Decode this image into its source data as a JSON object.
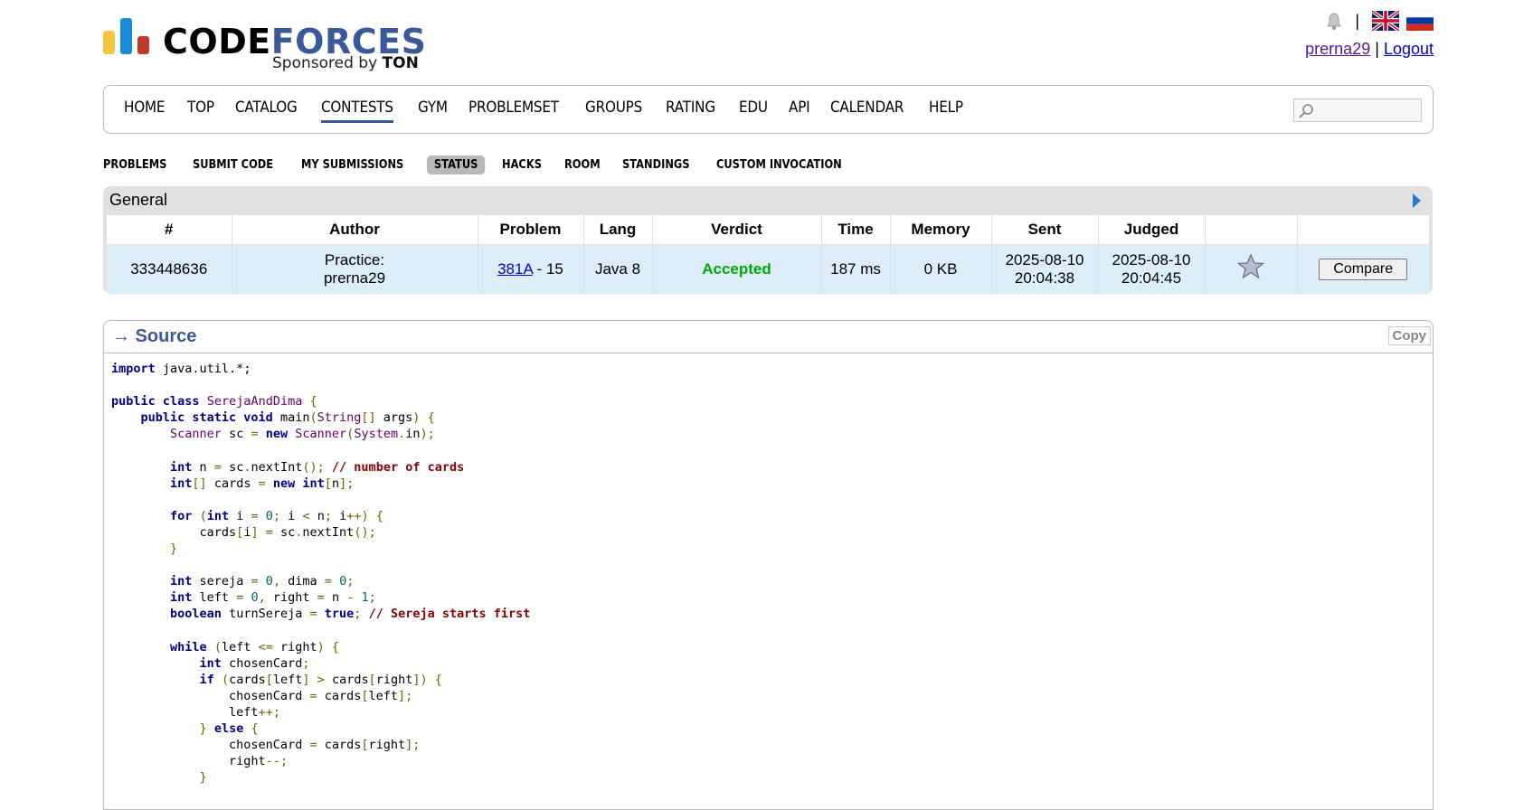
{
  "header": {
    "logo_main": "CODE",
    "logo_accent": "FORCES",
    "sponsor_prefix": "Sponsored by ",
    "sponsor_name": "TON",
    "username": "prerna29",
    "separator": "|",
    "logout": "Logout"
  },
  "menu": {
    "items": [
      "HOME",
      "TOP",
      "CATALOG",
      "CONTESTS",
      "GYM",
      "PROBLEMSET",
      "GROUPS",
      "RATING",
      "EDU",
      "API",
      "CALENDAR",
      "HELP"
    ],
    "active": "CONTESTS",
    "search_placeholder": ""
  },
  "submenu": {
    "items": [
      "PROBLEMS",
      "SUBMIT CODE",
      "MY SUBMISSIONS",
      "STATUS",
      "HACKS",
      "ROOM",
      "STANDINGS",
      "CUSTOM INVOCATION"
    ],
    "selected": "STATUS"
  },
  "status": {
    "title": "General",
    "headers": [
      "#",
      "Author",
      "Problem",
      "Lang",
      "Verdict",
      "Time",
      "Memory",
      "Sent",
      "Judged",
      "",
      ""
    ],
    "row": {
      "id": "333448636",
      "author_line1": "Practice:",
      "author_line2": "prerna29",
      "problem_link": "381A",
      "problem_suffix": " - 15",
      "lang": "Java 8",
      "verdict": "Accepted",
      "time": "187 ms",
      "memory": "0 KB",
      "sent_date": "2025-08-10",
      "sent_time": "20:04:38",
      "judged_date": "2025-08-10",
      "judged_time": "20:04:45",
      "compare": "Compare"
    }
  },
  "source": {
    "title": "→ Source",
    "copy": "Copy"
  },
  "colors": {
    "accent": "#3b5998",
    "accepted": "#00aa00",
    "row_bg": "#ddeefb"
  }
}
